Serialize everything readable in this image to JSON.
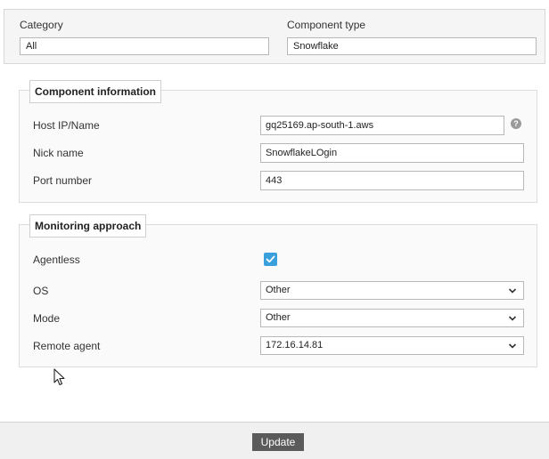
{
  "top": {
    "category_label": "Category",
    "category_value": "All",
    "component_type_label": "Component type",
    "component_type_value": "Snowflake"
  },
  "component_info": {
    "legend": "Component information",
    "host_label": "Host IP/Name",
    "host_value": "gq25169.ap-south-1.aws",
    "help_icon": "?",
    "nick_label": "Nick name",
    "nick_value": "SnowflakeLOgin",
    "port_label": "Port number",
    "port_value": "443"
  },
  "monitoring": {
    "legend": "Monitoring approach",
    "agentless_label": "Agentless",
    "agentless_checked": true,
    "os_label": "OS",
    "os_value": "Other",
    "mode_label": "Mode",
    "mode_value": "Other",
    "remote_agent_label": "Remote agent",
    "remote_agent_value": "172.16.14.81"
  },
  "footer": {
    "update_label": "Update"
  },
  "colors": {
    "checkbox": "#3aa0dc",
    "button": "#5b5b5b"
  }
}
